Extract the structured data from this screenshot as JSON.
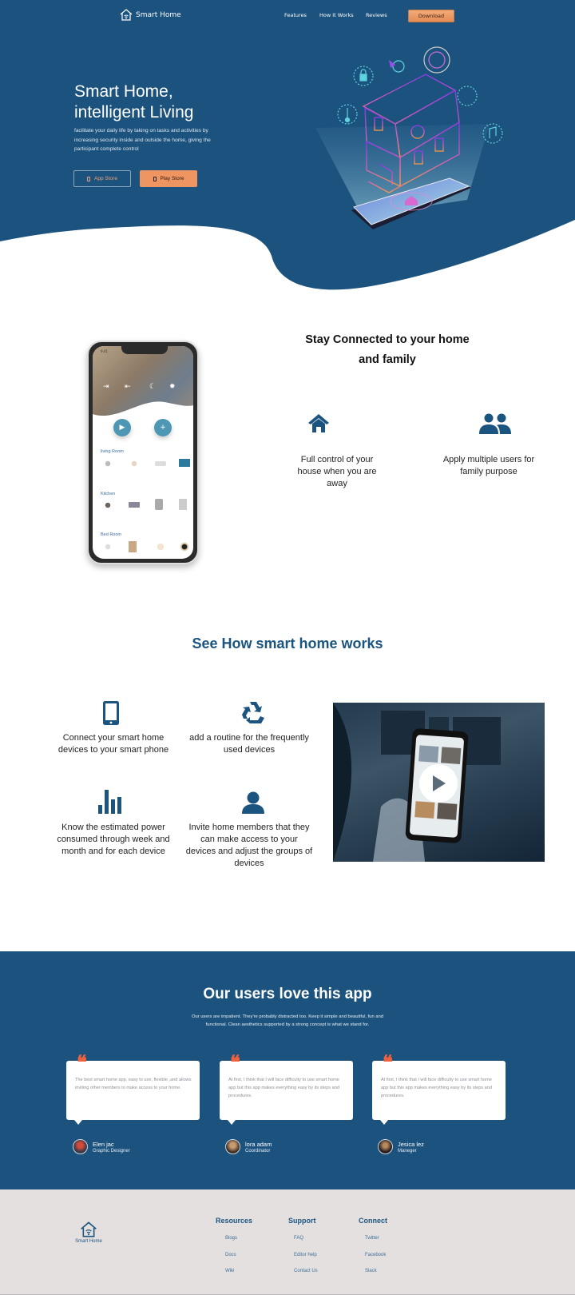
{
  "header": {
    "brand": "Smart Home",
    "nav": [
      "Features",
      "How It Works",
      "Reviews"
    ],
    "download_label": "Download"
  },
  "hero": {
    "title_line1": "Smart Home,",
    "title_line2": "intelligent  Living",
    "subtitle": "facilitate  your daily life by taking on tasks and activities by increasing security inside and outside the home, giving the participant complete control",
    "app_store_label": "App Store",
    "play_store_label": "Play Store",
    "illustration": "isometric-smart-house-over-phone"
  },
  "connected": {
    "title_line1": "Stay Connected to your home",
    "title_line2": "and family",
    "features": [
      {
        "icon": "home-icon",
        "text": "Full control of your house when you are away"
      },
      {
        "icon": "users-icon",
        "text": "Apply multiple users for family purpose"
      }
    ],
    "phone": {
      "status_time": "9:41",
      "rooms": [
        "living Room",
        "Kitchen",
        "Bed Room"
      ]
    }
  },
  "how": {
    "title": "See How smart home works",
    "steps": [
      {
        "icon": "tablet-icon",
        "text": "Connect your smart home devices to your smart phone"
      },
      {
        "icon": "recycle-icon",
        "text": "add a routine for the frequently used devices"
      },
      {
        "icon": "bar-chart-icon",
        "text": "Know the estimated power consumed through week and month and for each device"
      },
      {
        "icon": "user-icon",
        "text": "Invite home members that they can make access to your devices and adjust the groups of devices"
      }
    ],
    "video": {
      "icon": "play-icon"
    }
  },
  "testimonials": {
    "title": "Our users love this app",
    "subtitle": "Our users are impatient. They're probably distracted too. Keep it simple and beautiful, fun and functional. Clean aesthetics supported by a strong concept is what we stand for.",
    "items": [
      {
        "quote": "The best smart home app,  easy to use, flexible ,and allows inviting other members to make access to your home.",
        "name": "Elen jac",
        "role": "Graphic Designer"
      },
      {
        "quote": "At first, I think that I will face difficulty to use smart home app but this app makes everything easy by its steps and procedures.",
        "name": "lora adam",
        "role": "Coordinator"
      },
      {
        "quote": "At first, I think that I will face difficulty to use smart home app but this app makes everything easy by its steps and procedures.",
        "name": "Jesica lez",
        "role": "Maneger"
      }
    ],
    "accent_color": "#f0603f"
  },
  "footer": {
    "brand": "Smart Home",
    "columns": [
      {
        "title": "Resources",
        "links": [
          "Blogs",
          "Docs",
          "Wiki"
        ]
      },
      {
        "title": "Support",
        "links": [
          "FAQ",
          "Editor  help",
          "Contact Us"
        ]
      },
      {
        "title": "Connect",
        "links": [
          "Twitter",
          "Facebook",
          "Slack"
        ]
      }
    ]
  },
  "colors": {
    "primary": "#1c527e",
    "accent_orange": "#ee9562",
    "footer_bg": "#e4e0e0"
  }
}
